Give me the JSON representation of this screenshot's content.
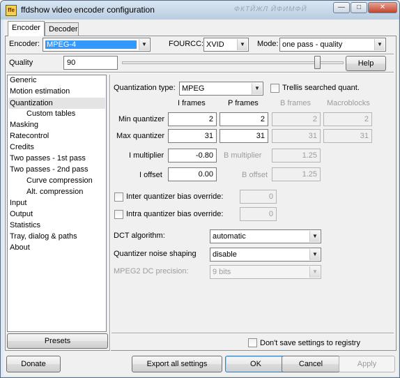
{
  "window": {
    "title": "ffdshow video encoder configuration",
    "title_obscured": "ФКТЙЖЛ ЙФИМФЙ"
  },
  "tabs": [
    {
      "label": "Encoder"
    },
    {
      "label": "Decoder"
    }
  ],
  "encoder": {
    "encoder_label": "Encoder:",
    "encoder_value": "MPEG-4",
    "fourcc_label": "FOURCC:",
    "fourcc_value": "XVID",
    "mode_label": "Mode:",
    "mode_value": "one pass - quality",
    "quality_label": "Quality",
    "quality_value": "90",
    "help_label": "Help"
  },
  "sidebar": {
    "items": [
      {
        "label": "Generic"
      },
      {
        "label": "Motion estimation"
      },
      {
        "label": "Quantization"
      },
      {
        "label": "Custom tables"
      },
      {
        "label": "Masking"
      },
      {
        "label": "Ratecontrol"
      },
      {
        "label": "Credits"
      },
      {
        "label": "Two passes - 1st pass"
      },
      {
        "label": "Two passes - 2nd pass"
      },
      {
        "label": "Curve compression"
      },
      {
        "label": "Alt. compression"
      },
      {
        "label": "Input"
      },
      {
        "label": "Output"
      },
      {
        "label": "Statistics"
      },
      {
        "label": "Tray, dialog & paths"
      },
      {
        "label": "About"
      }
    ],
    "presets_label": "Presets"
  },
  "quantization": {
    "type_label": "Quantization type:",
    "type_value": "MPEG",
    "trellis_label": "Trellis searched quant.",
    "col_headers": [
      "I frames",
      "P frames",
      "B frames",
      "Macroblocks"
    ],
    "min_label": "Min quantizer",
    "min_values": [
      "2",
      "2",
      "2",
      "2"
    ],
    "max_label": "Max quantizer",
    "max_values": [
      "31",
      "31",
      "31",
      "31"
    ],
    "i_mult_label": "I multiplier",
    "i_mult_value": "-0.80",
    "b_mult_label": "B multiplier",
    "b_mult_value": "1.25",
    "i_offset_label": "I offset",
    "i_offset_value": "0.00",
    "b_offset_label": "B offset",
    "b_offset_value": "1.25",
    "inter_label": "Inter quantizer bias override:",
    "inter_value": "0",
    "intra_label": "Intra quantizer bias override:",
    "intra_value": "0",
    "dct_label": "DCT algorithm:",
    "dct_value": "automatic",
    "noise_label": "Quantizer noise shaping",
    "noise_value": "disable",
    "mpeg2_label": "MPEG2 DC precision:",
    "mpeg2_value": "9 bits"
  },
  "footer": {
    "dont_save_label": "Don't save settings to registry",
    "donate_label": "Donate",
    "export_label": "Export all settings",
    "ok_label": "OK",
    "cancel_label": "Cancel",
    "apply_label": "Apply"
  }
}
